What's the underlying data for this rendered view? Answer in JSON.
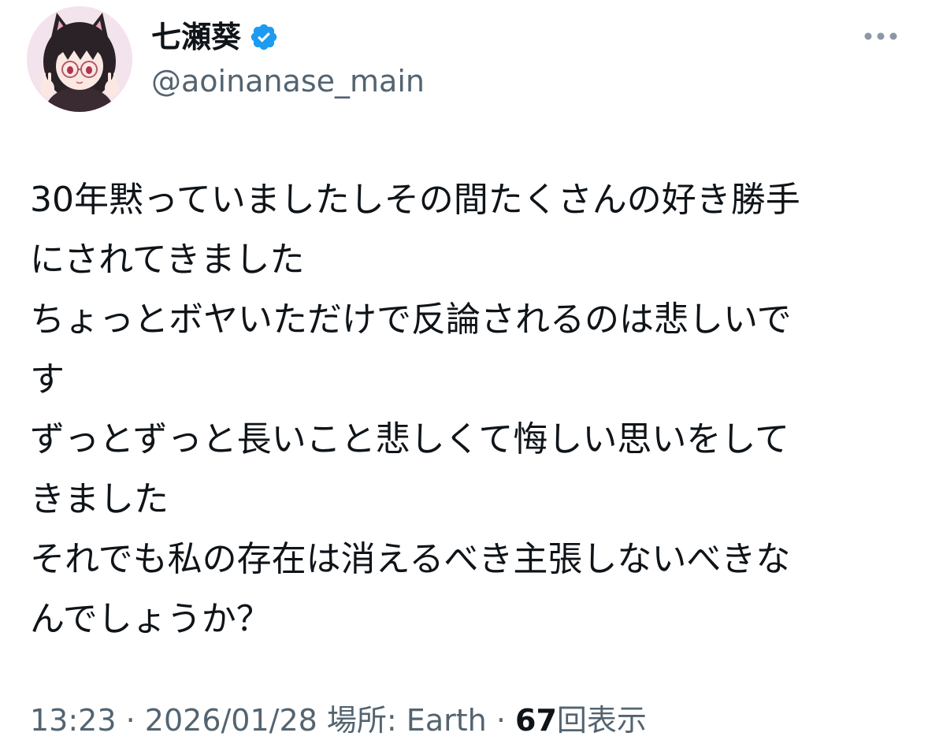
{
  "author": {
    "display_name": "七瀬葵",
    "handle": "@aoinanase_main",
    "verified": true,
    "verified_color": "#1d9bf0"
  },
  "more_icon": "more-horizontal-icon",
  "tweet": {
    "lines": [
      "30年黙っていましたしその間たくさんの好き勝手",
      "にされてきました",
      "ちょっとボヤいただけで反論されるのは悲しいで",
      "す",
      "ずっとずっと長いこと悲しくて悔しい思いをして",
      "きました",
      "それでも私の存在は消えるべき主張しないべきな",
      "んでしょうか？"
    ]
  },
  "meta": {
    "time": "13:23",
    "date": "2026/01/28",
    "location_label": "場所: Earth",
    "separator": "·",
    "views_count": "67",
    "views_label": "回表示"
  }
}
